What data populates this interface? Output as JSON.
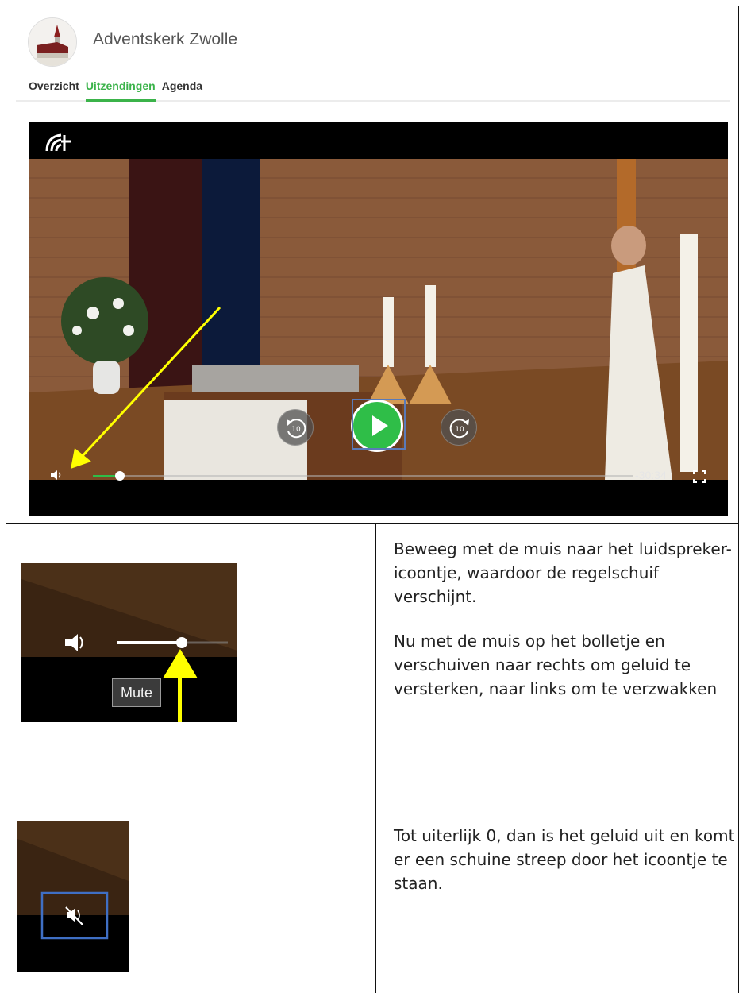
{
  "site": {
    "title": "Adventskerk Zwolle",
    "nav": [
      {
        "label": "Overzicht",
        "active": false
      },
      {
        "label": "Uitzendingen",
        "active": true
      },
      {
        "label": "Agenda",
        "active": false
      }
    ],
    "accent_color": "#3bb34a"
  },
  "player": {
    "logo_icon": "broadcast-logo-icon",
    "remaining_time": "-30:34",
    "rewind_label": "10",
    "forward_label": "10",
    "progress": 0.05,
    "annotation_color": "#ffff00"
  },
  "instructions": {
    "step1_line1": "Beweeg met de muis naar het luidspreker-icoontje, waardoor de regelschuif verschijnt.",
    "step1_line2": "Nu met de muis op het bolletje en verschuiven naar rechts om geluid te versterken, naar links om te verzwakken",
    "step1_tooltip": "Mute",
    "step2_text": "Tot uiterlijk 0, dan is het geluid uit en komt er een schuine streep door het icoontje te staan."
  }
}
